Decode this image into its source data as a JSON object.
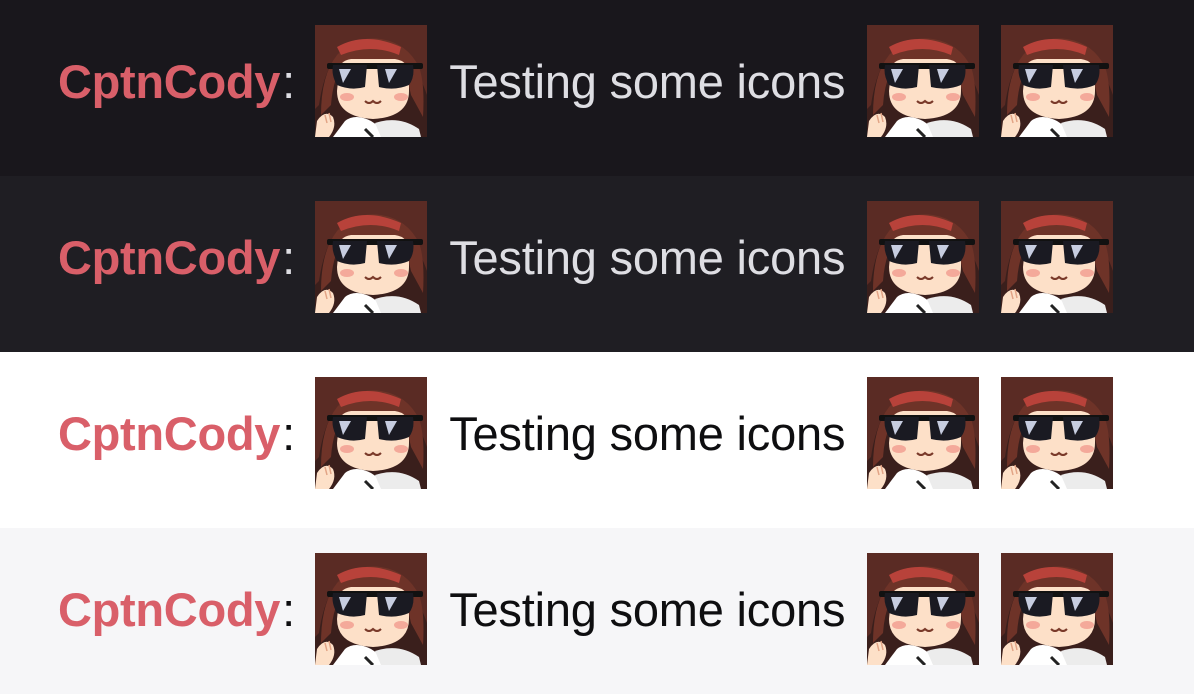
{
  "colors": {
    "username": "#d95f69",
    "dark_text": "#dedee3",
    "light_text": "#0e0e10"
  },
  "emote": {
    "name": "sunglasses-emote-icon"
  },
  "messages": [
    {
      "theme": "dark",
      "username": "CptnCody",
      "separator": ":",
      "text": "Testing some icons"
    },
    {
      "theme": "dark-alt",
      "username": "CptnCody",
      "separator": ":",
      "text": "Testing some icons"
    },
    {
      "theme": "light",
      "username": "CptnCody",
      "separator": ":",
      "text": "Testing some icons"
    },
    {
      "theme": "light-alt",
      "username": "CptnCody",
      "separator": ":",
      "text": "Testing some icons"
    }
  ]
}
